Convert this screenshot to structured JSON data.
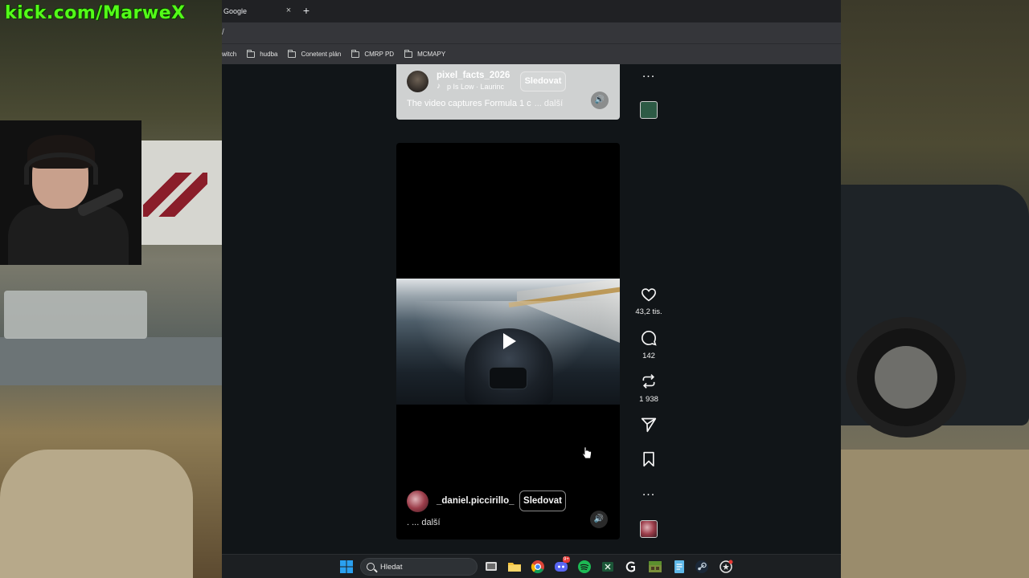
{
  "overlay": {
    "streamer_url": "kick.com/MarweX"
  },
  "browser": {
    "tab": {
      "title": "Google",
      "close": "×"
    },
    "new_tab": "+",
    "address": "/",
    "bookmarks": [
      {
        "label": "witch",
        "has_folder_icon": false
      },
      {
        "label": "hudba",
        "has_folder_icon": true
      },
      {
        "label": "Conetent plán",
        "has_folder_icon": true
      },
      {
        "label": "CMRP PD",
        "has_folder_icon": true
      },
      {
        "label": "MCMAPY",
        "has_folder_icon": true
      }
    ]
  },
  "top_reel": {
    "username": "pixel_facts_2026",
    "music": "p Is Low · Laurinc",
    "follow_label": "Sledovat",
    "caption": "The video captures Formula 1 c",
    "caption_more": "... další",
    "sound_icon": "speaker-icon"
  },
  "reel": {
    "username": "_daniel.piccirillo_",
    "follow_label": "Sledovat",
    "caption": ". ... další",
    "play_icon": "play-icon",
    "sound_icon": "speaker-icon"
  },
  "actions": {
    "top_more": "...",
    "like_count": "43,2 tis.",
    "comment_count": "142",
    "repost_count": "1 938",
    "bottom_more": "..."
  },
  "taskbar": {
    "search_placeholder": "Hledat",
    "discord_badge": "9+",
    "colors": {
      "accent_start": "#2aa0f0",
      "chrome_red": "#db4437",
      "spotify": "#1db954"
    }
  }
}
